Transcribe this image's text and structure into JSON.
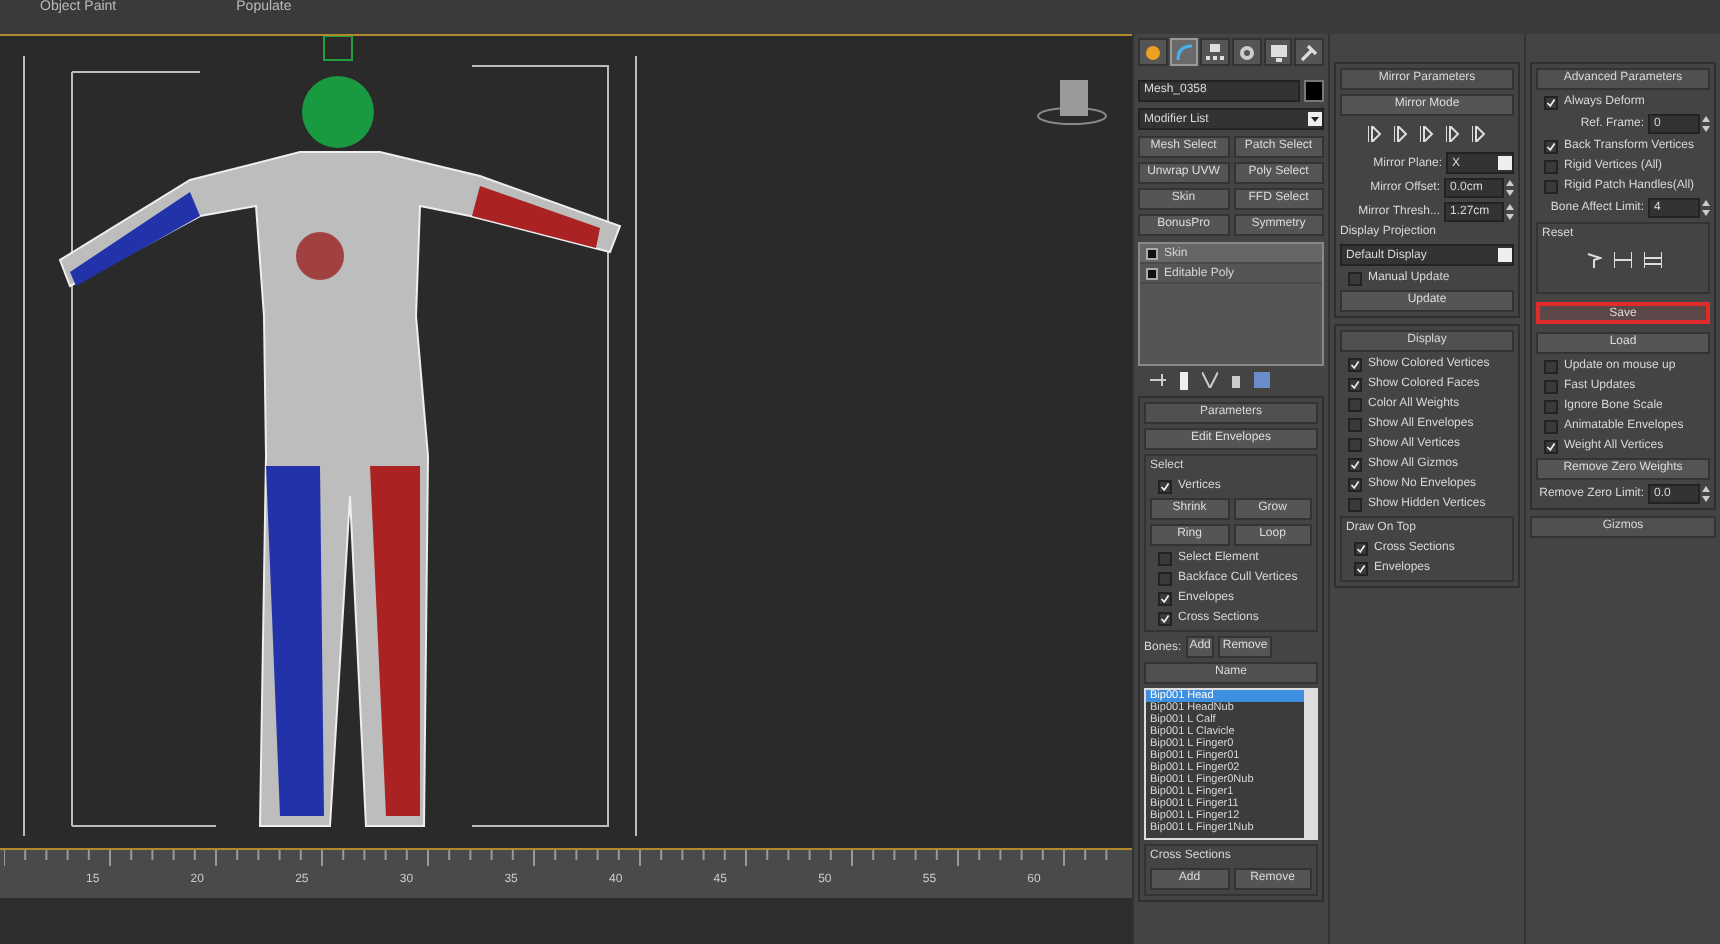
{
  "top_tabs": [
    {
      "label": "Object Paint"
    },
    {
      "label": "Populate"
    }
  ],
  "timeline": {
    "ticks": [
      "15",
      "20",
      "25",
      "30",
      "35",
      "40",
      "45",
      "50",
      "55",
      "60"
    ]
  },
  "command_panel": {
    "tabs": [
      {
        "kind": "create",
        "selected": false
      },
      {
        "kind": "modify",
        "selected": true
      },
      {
        "kind": "hierarchy",
        "selected": false
      },
      {
        "kind": "motion",
        "selected": false
      },
      {
        "kind": "display",
        "selected": false
      },
      {
        "kind": "utilities",
        "selected": false
      }
    ],
    "object_name": "Mesh_0358",
    "modifier_list": "Modifier List",
    "modifier_buttons": [
      "Mesh Select",
      "Patch Select",
      "Unwrap UVW",
      "Poly Select",
      "Skin",
      "FFD Select",
      "BonusPro",
      "Symmetry"
    ],
    "stack": [
      {
        "label": "Skin",
        "selected": true
      },
      {
        "label": "Editable Poly",
        "selected": false
      }
    ]
  },
  "parameters": {
    "title": "Parameters",
    "edit_envelopes": "Edit Envelopes",
    "select_label": "Select",
    "vertices": {
      "label": "Vertices",
      "checked": true
    },
    "buttons": [
      "Shrink",
      "Grow",
      "Ring",
      "Loop"
    ],
    "options": [
      {
        "label": "Select Element",
        "checked": false
      },
      {
        "label": "Backface Cull Vertices",
        "checked": false
      },
      {
        "label": "Envelopes",
        "checked": true
      },
      {
        "label": "Cross Sections",
        "checked": true
      }
    ],
    "bones_label": "Bones:",
    "add": "Add",
    "remove": "Remove",
    "name_header": "Name",
    "bones": [
      {
        "label": "Bip001 Head",
        "selected": true
      },
      {
        "label": "Bip001 HeadNub",
        "selected": false
      },
      {
        "label": "Bip001 L Calf",
        "selected": false
      },
      {
        "label": "Bip001 L Clavicle",
        "selected": false
      },
      {
        "label": "Bip001 L Finger0",
        "selected": false
      },
      {
        "label": "Bip001 L Finger01",
        "selected": false
      },
      {
        "label": "Bip001 L Finger02",
        "selected": false
      },
      {
        "label": "Bip001 L Finger0Nub",
        "selected": false
      },
      {
        "label": "Bip001 L Finger1",
        "selected": false
      },
      {
        "label": "Bip001 L Finger11",
        "selected": false
      },
      {
        "label": "Bip001 L Finger12",
        "selected": false
      },
      {
        "label": "Bip001 L Finger1Nub",
        "selected": false
      }
    ],
    "cross_sections": {
      "title": "Cross Sections",
      "add": "Add",
      "remove": "Remove"
    }
  },
  "mirror": {
    "title": "Mirror Parameters",
    "mirror_mode": "Mirror Mode",
    "plane_label": "Mirror Plane:",
    "plane": "X",
    "offset_label": "Mirror Offset:",
    "offset": "0.0cm",
    "threshold_label": "Mirror Thresh...",
    "threshold": "1.27cm",
    "projection_label": "Display Projection",
    "projection": "Default Display",
    "manual_update": {
      "label": "Manual Update",
      "checked": false
    },
    "update": "Update"
  },
  "display": {
    "title": "Display",
    "options": [
      {
        "label": "Show Colored Vertices",
        "checked": true
      },
      {
        "label": "Show Colored Faces",
        "checked": true
      },
      {
        "label": "Color All Weights",
        "checked": false
      },
      {
        "label": "Show All Envelopes",
        "checked": false
      },
      {
        "label": "Show All Vertices",
        "checked": false
      },
      {
        "label": "Show All Gizmos",
        "checked": true
      },
      {
        "label": "Show No Envelopes",
        "checked": true
      },
      {
        "label": "Show Hidden Vertices",
        "checked": false
      }
    ],
    "draw_on_top": {
      "title": "Draw On Top",
      "options": [
        {
          "label": "Cross Sections",
          "checked": true
        },
        {
          "label": "Envelopes",
          "checked": true
        }
      ]
    }
  },
  "advanced": {
    "title": "Advanced Parameters",
    "always_deform": {
      "label": "Always Deform",
      "checked": true
    },
    "ref_frame_label": "Ref. Frame:",
    "ref_frame": "0",
    "options": [
      {
        "label": "Back Transform Vertices",
        "checked": true
      },
      {
        "label": "Rigid Vertices (All)",
        "checked": false
      },
      {
        "label": "Rigid Patch Handles(All)",
        "checked": false
      }
    ],
    "bone_limit_label": "Bone Affect Limit:",
    "bone_limit": "4",
    "reset_label": "Reset",
    "save": {
      "label": "Save",
      "highlighted": true
    },
    "load": "Load",
    "options2": [
      {
        "label": "Update on mouse up",
        "checked": false
      },
      {
        "label": "Fast Updates",
        "checked": false
      },
      {
        "label": "Ignore Bone Scale",
        "checked": false
      },
      {
        "label": "Animatable Envelopes",
        "checked": false
      },
      {
        "label": "Weight All Vertices",
        "checked": true
      }
    ],
    "remove_zero": "Remove Zero Weights",
    "zero_limit_label": "Remove Zero Limit:",
    "zero_limit": "0.0"
  },
  "gizmos": {
    "title": "Gizmos"
  }
}
